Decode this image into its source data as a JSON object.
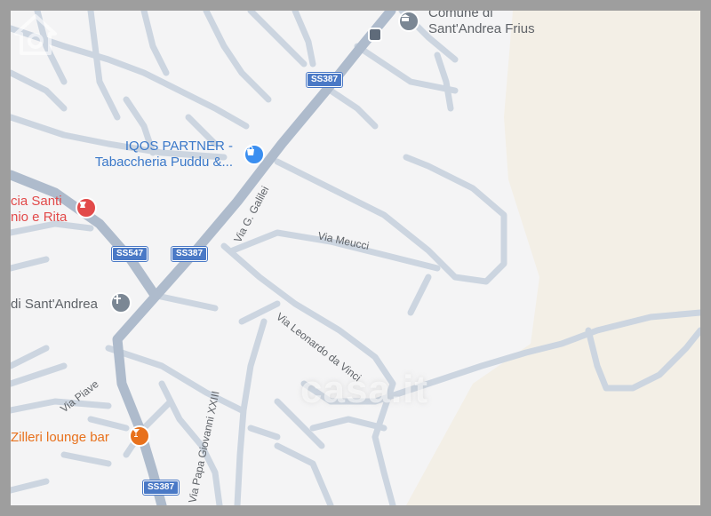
{
  "map": {
    "pois": {
      "comune": {
        "line1": "Comune di",
        "line2": "Sant'Andrea Frius"
      },
      "iqos": {
        "line1": "IQOS PARTNER -",
        "line2": "Tabaccheria Puddu &..."
      },
      "farmacia": {
        "line1": "cia Santi",
        "line2": "nio e Rita"
      },
      "chiesa": {
        "label": "di Sant'Andrea"
      },
      "bar": {
        "label": "Zilleri lounge bar"
      }
    },
    "shields": {
      "ss387_top": "SS387",
      "ss547": "SS547",
      "ss387_mid": "SS387",
      "ss387_bottom": "SS387"
    },
    "roads": {
      "via_g_galilei": "Via G. Galilei",
      "via_meucci": "Via Meucci",
      "via_leonardo_da_vinci": "Via Leonardo da Vinci",
      "via_piave": "Via Piave",
      "via_papa_giovanni": "Via Papa Giovanni XXIII"
    },
    "watermark": "casa.it",
    "colors": {
      "background": "#f4f4f5",
      "land_beige": "#f3efe6",
      "minor_road": "#ccd5e0",
      "major_road": "#aebbcc",
      "frame": "#9e9e9e"
    },
    "icons": {
      "comune": "town-hall-icon",
      "iqos": "shopping-bag-icon",
      "farmacia": "pharmacy-icon",
      "chiesa": "church-cross-icon",
      "bar": "cocktail-glass-icon",
      "bus": "bus-stop-icon"
    }
  }
}
